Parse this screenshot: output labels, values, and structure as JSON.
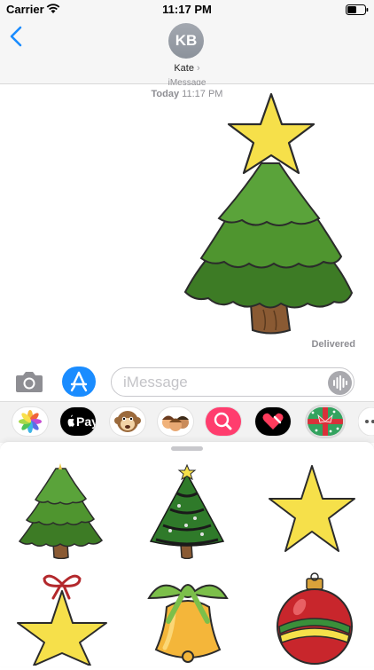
{
  "status": {
    "carrier": "Carrier",
    "time": "11:17 PM"
  },
  "header": {
    "initials": "KB",
    "contact_name": "Kate",
    "contact_chevron": "›"
  },
  "conversation": {
    "service": "iMessage",
    "day": "Today",
    "time": "11:17 PM",
    "delivery_status": "Delivered"
  },
  "compose": {
    "placeholder": "iMessage"
  },
  "app_drawer": {
    "items": [
      "photos-app",
      "apple-pay",
      "animoji",
      "memoji",
      "web-images-search",
      "digital-touch",
      "christmas-stickers-app",
      "more-apps"
    ],
    "apple_pay_label": "Pay"
  },
  "stickers": [
    "plain-christmas-tree",
    "decorated-christmas-tree",
    "yellow-star",
    "star-ornament-with-bow",
    "bell-with-bow",
    "red-bauble-ornament"
  ],
  "colors": {
    "accent": "#1a8cff",
    "tree": "#3f8a2e",
    "star": "#f6e04a",
    "outline": "#2b2b2b"
  }
}
